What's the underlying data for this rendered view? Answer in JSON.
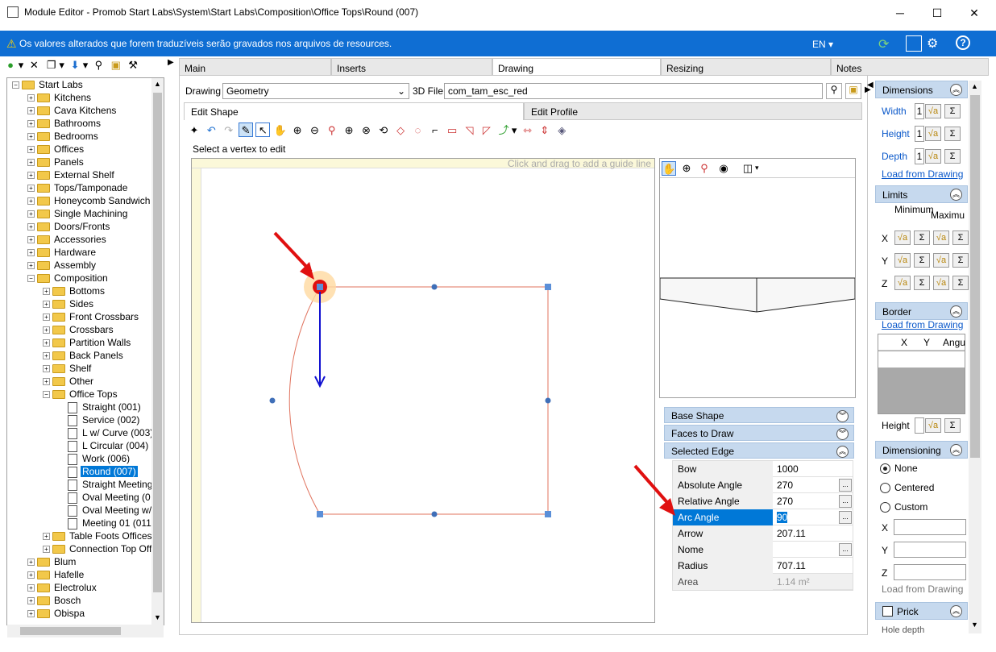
{
  "window": {
    "title": "Module Editor - Promob Start Labs\\System\\Start Labs\\Composition\\Office Tops\\Round (007)",
    "min": "─",
    "max": "☐",
    "close": "✕"
  },
  "notice": {
    "text": "Os valores alterados que forem traduzíveis serão gravados nos arquivos de resources.",
    "lang": "EN"
  },
  "tree": {
    "root": "Start Labs",
    "level1": [
      "Kitchens",
      "Cava Kitchens",
      "Bathrooms",
      "Bedrooms",
      "Offices",
      "Panels",
      "External Shelf",
      "Tops/Tamponade",
      "Honeycomb Sandwich",
      "Single Machining",
      "Doors/Fronts",
      "Accessories",
      "Hardware",
      "Assembly",
      "Composition"
    ],
    "composition": [
      "Bottoms",
      "Sides",
      "Front Crossbars",
      "Crossbars",
      "Partition Walls",
      "Back Panels",
      "Shelf",
      "Other",
      "Office Tops"
    ],
    "office_tops": [
      "Straight (001)",
      "Service (002)",
      "L w/ Curve (003)",
      "L Circular (004)",
      "Work (006)",
      "Round (007)",
      "Straight Meeting",
      "Oval Meeting (0",
      "Oval Meeting w/",
      "Meeting 01 (011)"
    ],
    "composition_tail": [
      "Table Foots Offices",
      "Connection Top Offi"
    ],
    "level1_tail": [
      "Blum",
      "Hafelle",
      "Electrolux",
      "Bosch",
      "Obispa"
    ]
  },
  "tabs": [
    "Main",
    "Inserts",
    "Drawing",
    "Resizing",
    "Notes"
  ],
  "drawing": {
    "label": "Drawing",
    "mode": "Geometry",
    "file_label": "3D File",
    "file": "com_tam_esc_red",
    "subtabs": [
      "Edit Shape",
      "Edit Profile"
    ],
    "status": "Select a vertex to edit",
    "guide_hint": "Click and drag to add a guide line"
  },
  "groups": [
    "Base Shape",
    "Faces to Draw",
    "Selected Edge"
  ],
  "edge": [
    {
      "name": "Bow",
      "value": "1000",
      "btn": false
    },
    {
      "name": "Absolute Angle",
      "value": "270",
      "btn": true
    },
    {
      "name": "Relative Angle",
      "value": "270",
      "btn": true
    },
    {
      "name": "Arc Angle",
      "value": "90",
      "btn": true
    },
    {
      "name": "Arrow",
      "value": "207.11",
      "btn": false
    },
    {
      "name": "Nome",
      "value": "",
      "btn": true
    },
    {
      "name": "Radius",
      "value": "707.11",
      "btn": false
    },
    {
      "name": "Area",
      "value": "1.14 m²",
      "btn": false
    }
  ],
  "right": {
    "dimensions": {
      "title": "Dimensions",
      "width": "Width",
      "height": "Height",
      "depth": "Depth",
      "one": "1",
      "load": "Load from Drawing"
    },
    "limits": {
      "title": "Limits",
      "min": "Minimum",
      "max": "Maximu",
      "x": "X",
      "y": "Y",
      "z": "Z"
    },
    "border": {
      "title": "Border",
      "load": "Load from Drawing",
      "cols": [
        "X",
        "Y",
        "Angu"
      ],
      "height": "Height"
    },
    "dimensioning": {
      "title": "Dimensioning",
      "opts": [
        "None",
        "Centered",
        "Custom"
      ],
      "x": "X",
      "y": "Y",
      "z": "Z",
      "load": "Load from Drawing"
    },
    "prick": {
      "title": "Prick",
      "hole": "Hole depth"
    }
  },
  "colors": {
    "accent": "#0f6ed3",
    "selection": "#0078d7",
    "shape": "#e0735e",
    "handle": "#5b8fd8",
    "arrow": "#1010d0",
    "annotation": "#e01010"
  }
}
